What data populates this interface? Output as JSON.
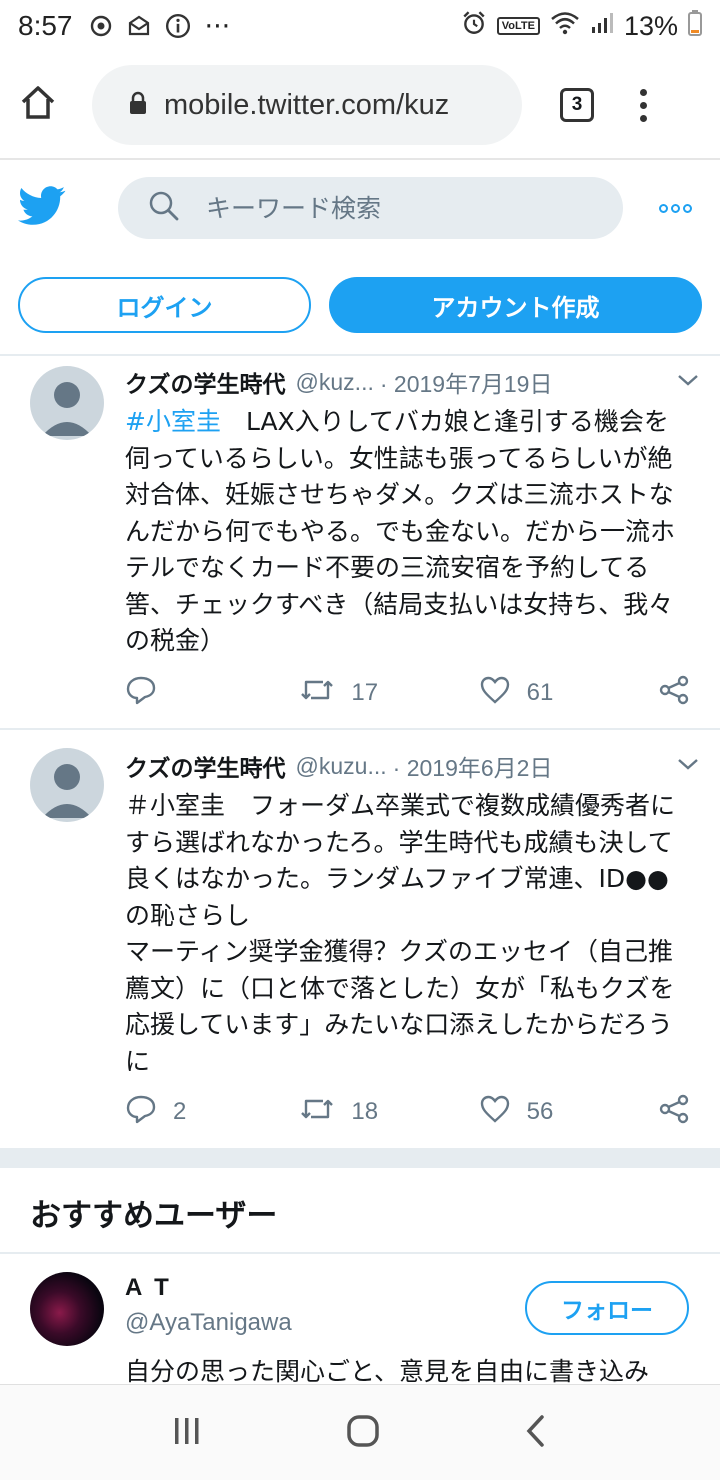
{
  "status_bar": {
    "time": "8:57",
    "extra": "···",
    "volte": "VoLTE",
    "battery": "13%"
  },
  "browser": {
    "url": "mobile.twitter.com/kuz",
    "tab_count": "3"
  },
  "search": {
    "placeholder": "キーワード検索"
  },
  "auth": {
    "login": "ログイン",
    "signup": "アカウント作成"
  },
  "tweets": [
    {
      "name": "クズの学生時代",
      "handle": "@kuz...",
      "date": "· 2019年7月19日",
      "hashtag": "#小室圭",
      "text": "　LAX入りしてバカ娘と逢引する機会を伺っているらしい。女性誌も張ってるらしいが絶対合体、妊娠させちゃダメ。クズは三流ホストなんだから何でもやる。でも金ない。だから一流ホテルでなくカード不要の三流安宿を予約してる筈、チェックすべき（結局支払いは女持ち、我々の税金）",
      "replies": "",
      "retweets": "17",
      "likes": "61"
    },
    {
      "name": "クズの学生時代",
      "handle": "@kuzu...",
      "date": "· 2019年6月2日",
      "text": "＃小室圭　フォーダム卒業式で複数成績優秀者にすら選ばれなかったろ。学生時代も成績も決して良くはなかった。ランダムファイブ常連、ID●●の恥さらし\nマーティン奨学金獲得？クズのエッセイ（自己推薦文）に（口と体で落とした）女が「私もクズを応援しています」みたいな口添えしたからだろうに",
      "replies": "2",
      "retweets": "18",
      "likes": "56"
    }
  ],
  "recommend": {
    "title": "おすすめユーザー",
    "user": {
      "name": "A T",
      "handle": "@AyaTanigawa",
      "follow": "フォロー",
      "bio": "自分の思った関心ごと、意見を自由に書き込み"
    }
  },
  "colors": {
    "accent": "#1da1f2",
    "muted": "#657786",
    "border": "#e6ecf0"
  }
}
